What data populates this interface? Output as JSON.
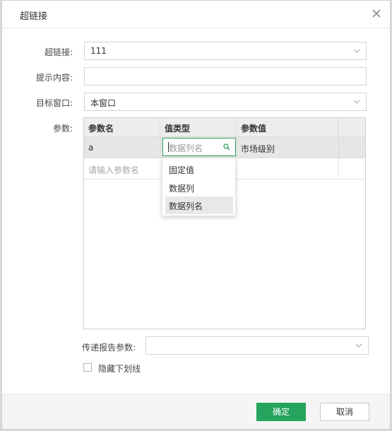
{
  "dialog": {
    "title": "超链接"
  },
  "form": {
    "hyperlink_label": "超链接:",
    "hyperlink_value": "111",
    "tooltip_label": "提示内容:",
    "tooltip_value": "",
    "target_label": "目标窗口:",
    "target_value": "本窗口",
    "params_label": "参数:"
  },
  "params_table": {
    "columns": [
      "参数名",
      "值类型",
      "参数值"
    ],
    "rows": [
      {
        "name": "a",
        "type_search_placeholder": "数据列名",
        "value": "市场级别"
      }
    ],
    "new_row_placeholder": "请输入参数名"
  },
  "type_dropdown": {
    "options": [
      "固定值",
      "数据列",
      "数据列名"
    ],
    "selected": "数据列名"
  },
  "pass_report_params": {
    "label": "传递报告参数:",
    "value": ""
  },
  "hide_underline": {
    "label": "隐藏下划线",
    "checked": false
  },
  "footer": {
    "ok_label": "确定",
    "cancel_label": "取消"
  },
  "colors": {
    "accent": "#25a45e",
    "header_bg": "#ededed",
    "selected_row": "#e6e6e6"
  }
}
